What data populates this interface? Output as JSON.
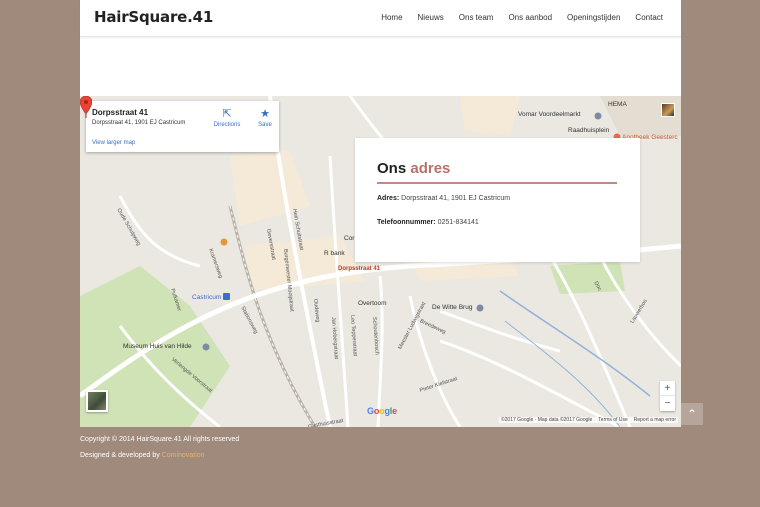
{
  "site": {
    "logo": "HairSquare.41",
    "nav": [
      "Home",
      "Nieuws",
      "Ons team",
      "Ons aanbod",
      "Openingstijden",
      "Contact"
    ]
  },
  "map": {
    "place_card": {
      "title": "Dorpsstraat 41",
      "address": "Dorpsstraat 41, 1901 EJ Castricum",
      "view_larger": "View larger map",
      "directions": "Directions",
      "save": "Save"
    },
    "marker_label": "Dorpsstraat 41",
    "pois": {
      "hema": "HEMA",
      "vomar": "Vomar Voordeelmarkt",
      "raadhuisplein": "Raadhuisplein",
      "apotheek": "Apotheek Geesterc",
      "castricum": "Castricum",
      "museum": "Museum Huis van Hilde",
      "witte_brug": "De Witte Brug",
      "overtoom": "Overtoom",
      "cor": "Cor",
      "rabobank": "R bank"
    },
    "streets": {
      "gasthuisstraat": "Gasthuisstraat",
      "geversstraat": "Geversstraat",
      "hein_schuitstraat": "Hein Schuitstraat",
      "kramersweg": "Kramersweg",
      "stationsweg": "Stationsweg",
      "oude_schulpweg": "Oude Schulpweg",
      "pulkamer": "Pulkamer",
      "verlengde": "Verlengde Voorstraat",
      "burgemeester": "Burgemeester Mooijstraat",
      "oudeweg": "Oudeweg",
      "jan_hobergstraat": "Jan Hobergstraat",
      "leo_tepperstraat": "Leo Tepperstraat",
      "schoutenbosch": "Schoutenbosch",
      "meester": "Meester Ludwigstraat",
      "breedeweg": "Breedeweg",
      "pieter": "Pieter Kiefstraat",
      "lauwerbos": "Lauwerbos",
      "schulpweg": "Schulpweg",
      "doc": "Doc"
    },
    "zoom_in": "+",
    "zoom_out": "−",
    "footer": {
      "data": "©2017 Google · Map data ©2017 Google",
      "terms": "Terms of Use",
      "report": "Report a map error"
    },
    "google": [
      "G",
      "o",
      "o",
      "g",
      "l",
      "e"
    ]
  },
  "info": {
    "title_word1": "Ons",
    "title_word2": "adres",
    "address_label": "Adres:",
    "address_value": "Dorpsstraat 41, 1901 EJ Castricum",
    "phone_label": "Telefoonnummer:",
    "phone_value": "0251-834141"
  },
  "footer": {
    "copyright": "Copyright © 2014 HairSquare.41 All rights reserved",
    "developed_prefix": "Designed & developed by",
    "developer": "Cominovation"
  },
  "colors": {
    "page_bg": "#a08a7c",
    "accent": "#b5736b",
    "link": "#e8b26b"
  }
}
